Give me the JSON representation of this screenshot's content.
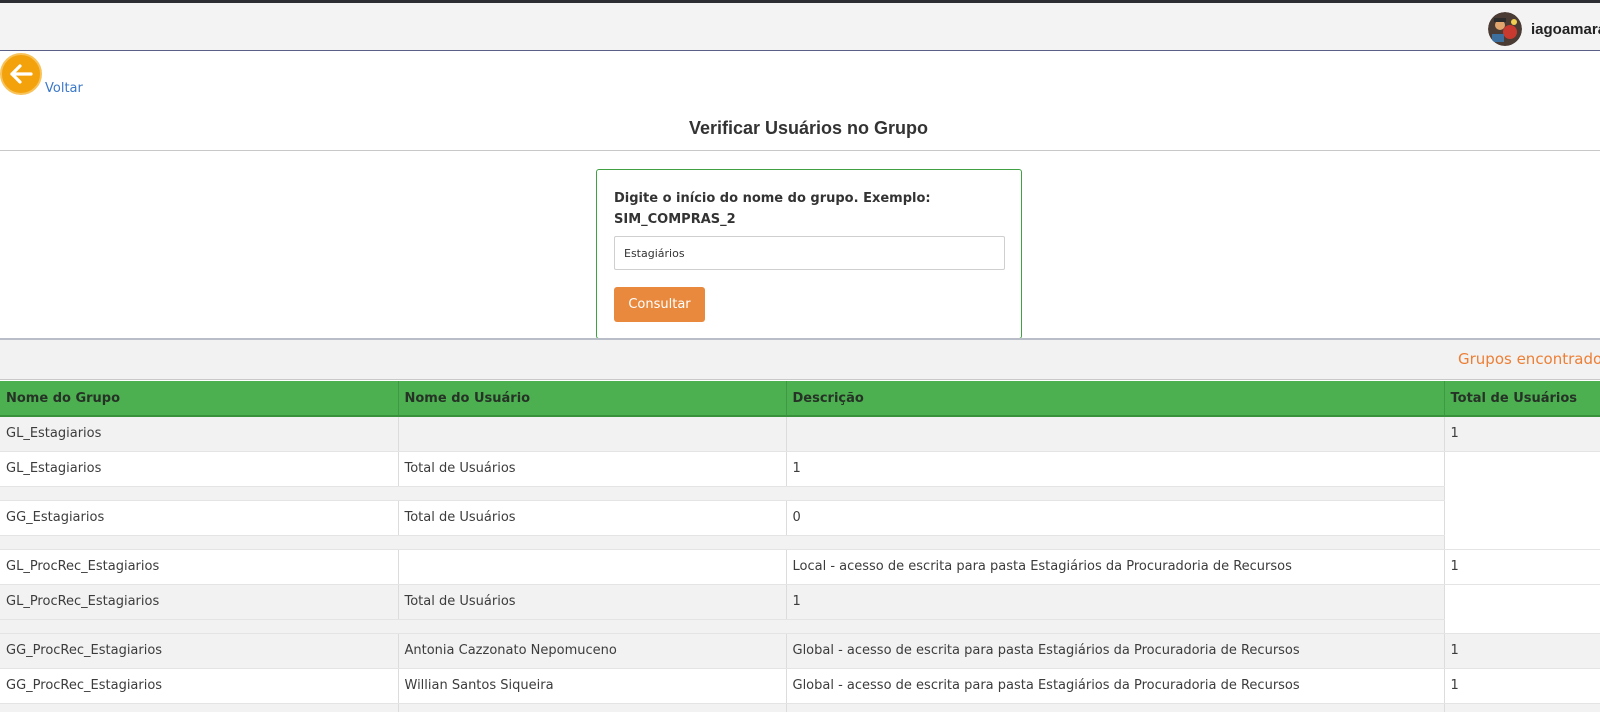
{
  "header": {
    "username": "iagoamaral"
  },
  "nav": {
    "back_label": "Voltar"
  },
  "page": {
    "title": "Verificar Usuários no Grupo"
  },
  "search": {
    "label": "Digite o início do nome do grupo. Exemplo: SIM_COMPRAS_2",
    "value": "Estagiários",
    "button_label": "Consultar"
  },
  "results": {
    "groups_found_label": "Grupos encontrados",
    "columns": [
      "Nome do Grupo",
      "Nome do Usuário",
      "Descrição",
      "Total de Usuários"
    ],
    "rows": [
      [
        "GL_Estagiarios",
        "",
        "",
        "1"
      ],
      [
        "GL_Estagiarios",
        "Total de Usuários",
        "1"
      ],
      [
        "GG_Estagiarios",
        "Total de Usuários",
        "0"
      ],
      [
        "GL_ProcRec_Estagiarios",
        "",
        "Local - acesso de escrita para pasta Estagiários da Procuradoria de Recursos",
        "1"
      ],
      [
        "GL_ProcRec_Estagiarios",
        "Total de Usuários",
        "1"
      ],
      [
        "GG_ProcRec_Estagiarios",
        "Antonia Cazzonato Nepomuceno",
        "Global - acesso de escrita para pasta Estagiários da Procuradoria de Recursos",
        "1"
      ],
      [
        "GG_ProcRec_Estagiarios",
        "Willian Santos Siqueira",
        "Global - acesso de escrita para pasta Estagiários da Procuradoria de Recursos",
        "1"
      ]
    ]
  },
  "colors": {
    "header_green": "#4caf50",
    "accent_orange": "#e8893e",
    "back_button": "#f4a20c",
    "link_blue": "#3b78c8",
    "card_border": "#3fa142"
  },
  "icons": {
    "back": "arrow-left-circle-icon",
    "avatar": "user-avatar"
  }
}
